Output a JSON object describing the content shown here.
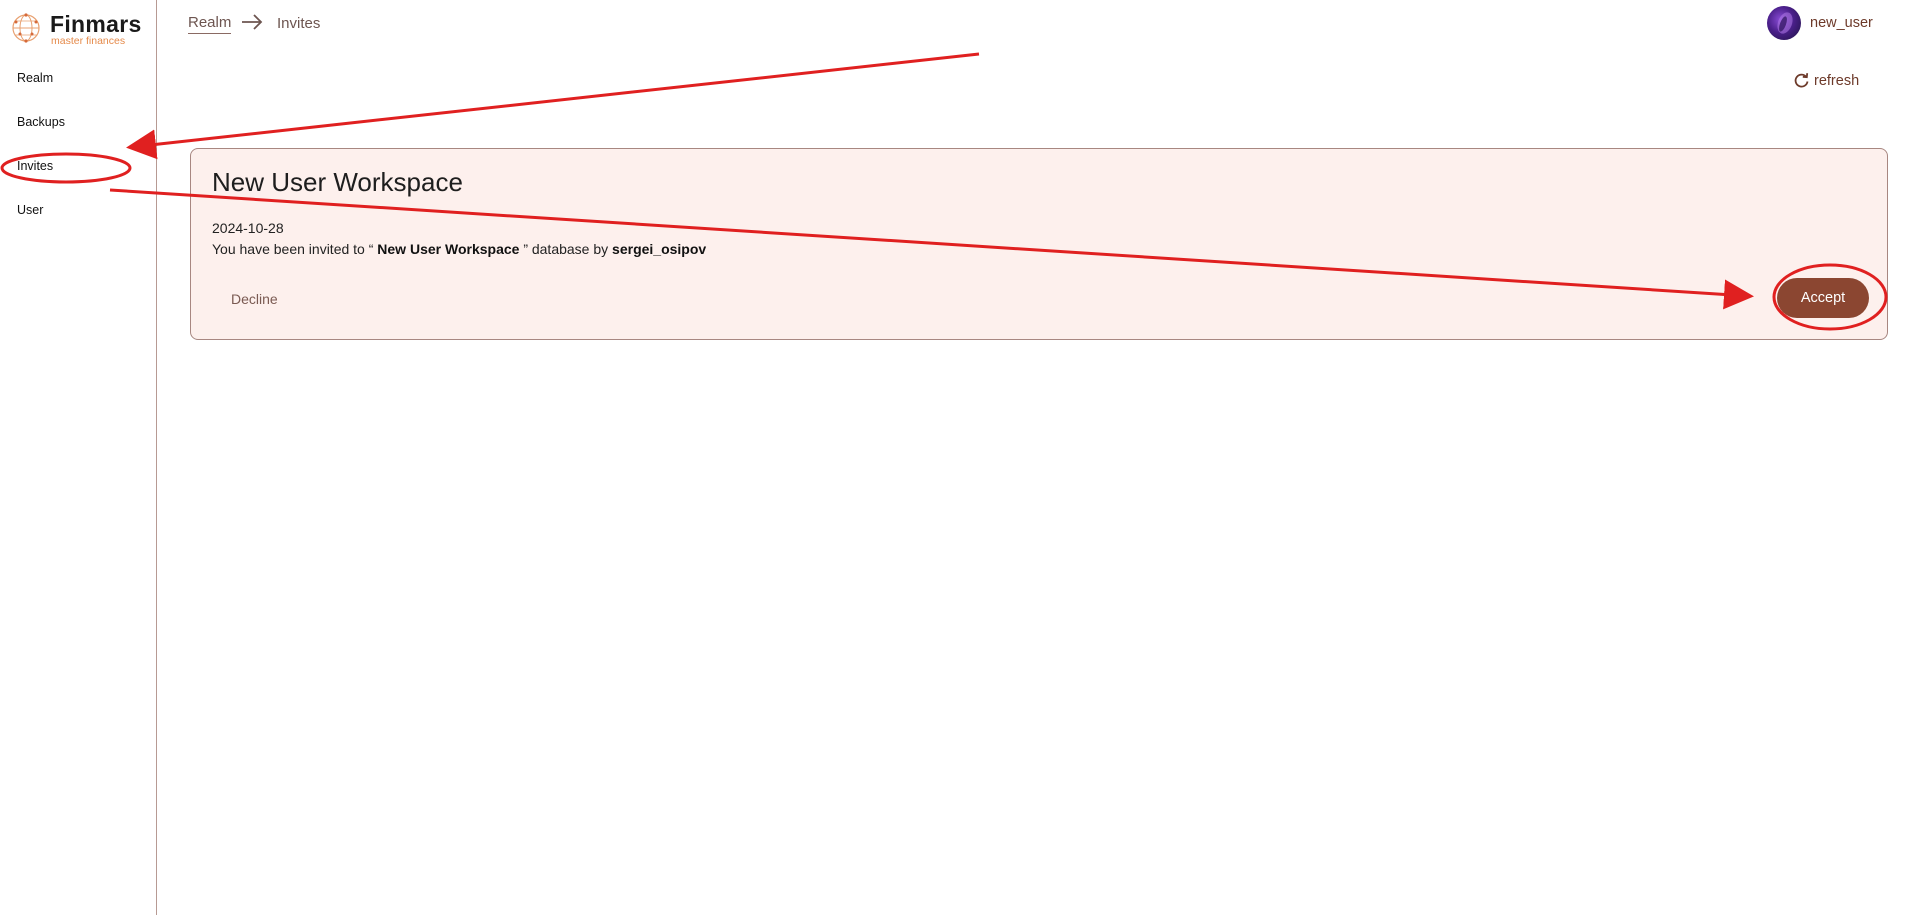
{
  "brand": {
    "name": "Finmars",
    "tagline": "master finances",
    "accent": "#e58a4a"
  },
  "sidebar": {
    "items": [
      {
        "label": "Realm"
      },
      {
        "label": "Backups"
      },
      {
        "label": "Invites"
      },
      {
        "label": "User"
      }
    ]
  },
  "breadcrumb": {
    "parent": "Realm",
    "current": "Invites"
  },
  "user": {
    "name": "new_user"
  },
  "toolbar": {
    "refresh_label": "refresh",
    "refresh_icon": "refresh-icon"
  },
  "invite": {
    "title": "New User Workspace",
    "date": "2024-10-28",
    "message_prefix": "You have been invited to “",
    "workspace": "New User Workspace",
    "message_middle": "” database by",
    "inviter": "sergei_osipov",
    "decline_label": "Decline",
    "accept_label": "Accept"
  },
  "colors": {
    "primary": "#8b4631",
    "card_bg": "#fdf0ed",
    "annotation": "#e02020"
  }
}
